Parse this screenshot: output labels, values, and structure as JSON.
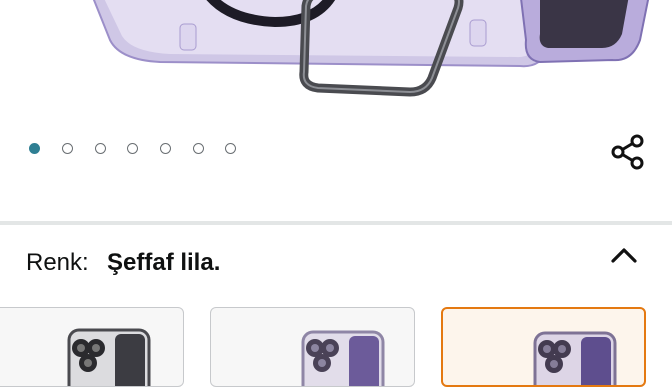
{
  "gallery": {
    "image_alt": "Transparent purple phone case with ring kickstand",
    "dots_total": 7,
    "active_index": 0,
    "active_color": "#2f7f93"
  },
  "share": {
    "icon": "share-icon"
  },
  "variant": {
    "label": "Renk:",
    "selected_value": "Şeffaf lila.",
    "collapse_icon": "chevron-up-icon",
    "accent_selected": "#e47911",
    "options": [
      {
        "tone": "black"
      },
      {
        "tone": "purple-light"
      },
      {
        "tone": "purple",
        "selected": true
      }
    ]
  }
}
